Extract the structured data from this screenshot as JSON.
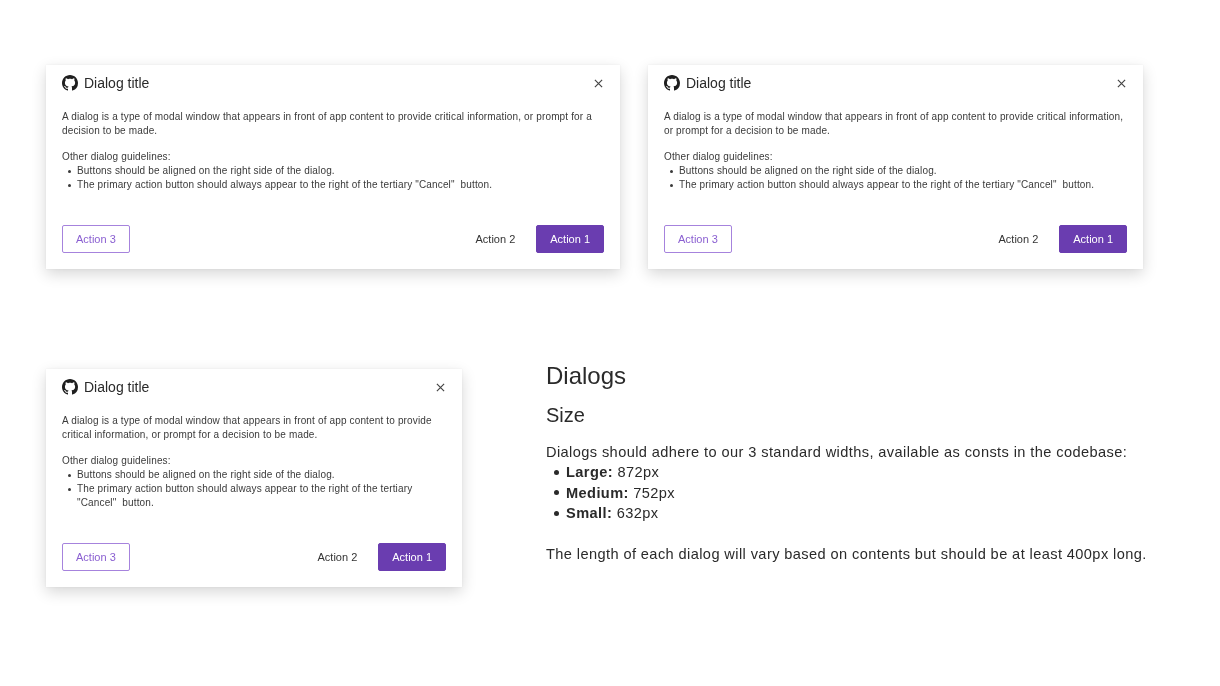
{
  "dialogs": [
    {
      "title": "Dialog title",
      "description": "A dialog is a type of modal window that appears in front of app content to provide critical information, or prompt for a decision to be made.",
      "guidelines_heading": "Other dialog guidelines:",
      "guidelines": [
        "Buttons should be aligned on the right side of the dialog.",
        "The primary action button should always appear to the right of the tertiary \"Cancel\"  button."
      ],
      "actions": [
        {
          "label": "Action 3",
          "kind": "outline"
        },
        {
          "label": "Action 2",
          "kind": "text"
        },
        {
          "label": "Action 1",
          "kind": "primary"
        }
      ]
    },
    {
      "title": "Dialog title",
      "description": "A dialog is a type of modal window that appears in front of app content to provide critical information, or prompt for a decision to be made.",
      "guidelines_heading": "Other dialog guidelines:",
      "guidelines": [
        "Buttons should be aligned on the right side of the dialog.",
        "The primary action button should always appear to the right of the tertiary \"Cancel\"  button."
      ],
      "actions": [
        {
          "label": "Action 3",
          "kind": "outline"
        },
        {
          "label": "Action 2",
          "kind": "text"
        },
        {
          "label": "Action 1",
          "kind": "primary"
        }
      ]
    },
    {
      "title": "Dialog title",
      "description": "A dialog is a type of modal window that appears in front of app content to provide critical information, or prompt for a decision to be made.",
      "guidelines_heading": "Other dialog guidelines:",
      "guidelines": [
        "Buttons should be aligned on the right side of the dialog.",
        "The primary action button should always appear to the right of the tertiary \"Cancel\"  button."
      ],
      "actions": [
        {
          "label": "Action 3",
          "kind": "outline"
        },
        {
          "label": "Action 2",
          "kind": "text"
        },
        {
          "label": "Action 1",
          "kind": "primary"
        }
      ]
    }
  ],
  "documentation": {
    "heading": "Dialogs",
    "subheading": "Size",
    "intro": "Dialogs should adhere to our 3 standard widths, available as consts in the codebase:",
    "sizes": [
      "**Large:** 872px",
      "**Medium:** 752px",
      "**Small:** 632px"
    ],
    "note": "The length of each dialog will vary based on contents but should be at least 400px long."
  }
}
